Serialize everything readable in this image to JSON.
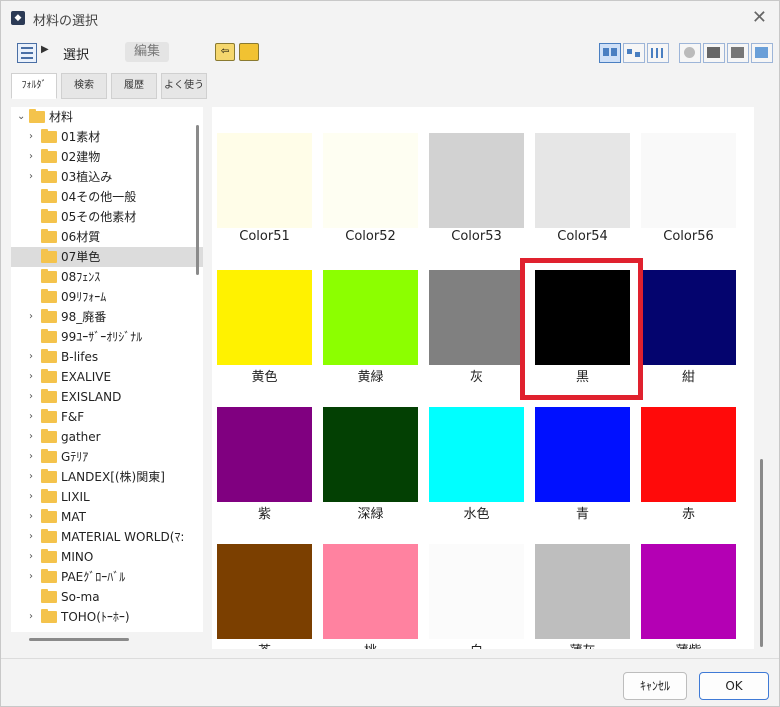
{
  "window": {
    "title": "材料の選択"
  },
  "toolbar": {
    "select_label": "選択",
    "edit_label": "編集"
  },
  "tabs": [
    "ﾌｫﾙﾀﾞ",
    "検索",
    "履歴",
    "よく使う"
  ],
  "tree": {
    "items": [
      {
        "label": "材料",
        "chev": "⌄",
        "level": 0,
        "selected": false
      },
      {
        "label": "01素材",
        "chev": "›",
        "level": 1,
        "selected": false
      },
      {
        "label": "02建物",
        "chev": "›",
        "level": 1,
        "selected": false
      },
      {
        "label": "03植込み",
        "chev": "›",
        "level": 1,
        "selected": false
      },
      {
        "label": "04その他一般",
        "chev": "",
        "level": 1,
        "selected": false
      },
      {
        "label": "05その他素材",
        "chev": "",
        "level": 1,
        "selected": false
      },
      {
        "label": "06材質",
        "chev": "",
        "level": 1,
        "selected": false
      },
      {
        "label": "07単色",
        "chev": "",
        "level": 1,
        "selected": true
      },
      {
        "label": "08ﾌｪﾝｽ",
        "chev": "",
        "level": 1,
        "selected": false
      },
      {
        "label": "09ﾘﾌｫｰﾑ",
        "chev": "",
        "level": 1,
        "selected": false
      },
      {
        "label": "98_廃番",
        "chev": "›",
        "level": 1,
        "selected": false
      },
      {
        "label": "99ﾕｰｻﾞｰｵﾘｼﾞﾅﾙ",
        "chev": "",
        "level": 1,
        "selected": false
      },
      {
        "label": "B-lifes",
        "chev": "›",
        "level": 1,
        "selected": false
      },
      {
        "label": "EXALIVE",
        "chev": "›",
        "level": 1,
        "selected": false
      },
      {
        "label": "EXISLAND",
        "chev": "›",
        "level": 1,
        "selected": false
      },
      {
        "label": "F&F",
        "chev": "›",
        "level": 1,
        "selected": false
      },
      {
        "label": "gather",
        "chev": "›",
        "level": 1,
        "selected": false
      },
      {
        "label": "Gﾃﾘｱ",
        "chev": "›",
        "level": 1,
        "selected": false
      },
      {
        "label": "LANDEX[(株)関東]",
        "chev": "›",
        "level": 1,
        "selected": false
      },
      {
        "label": "LIXIL",
        "chev": "›",
        "level": 1,
        "selected": false
      },
      {
        "label": "MAT",
        "chev": "›",
        "level": 1,
        "selected": false
      },
      {
        "label": "MATERIAL WORLD(ﾏ:",
        "chev": "›",
        "level": 1,
        "selected": false
      },
      {
        "label": "MINO",
        "chev": "›",
        "level": 1,
        "selected": false
      },
      {
        "label": "PAEｸﾞﾛｰﾊﾞﾙ",
        "chev": "›",
        "level": 1,
        "selected": false
      },
      {
        "label": "So-ma",
        "chev": "",
        "level": 1,
        "selected": false
      },
      {
        "label": "TOHO(ﾄｰﾎｰ)",
        "chev": "›",
        "level": 1,
        "selected": false
      }
    ]
  },
  "materials": [
    {
      "label": "Color51",
      "color": "#fffde8"
    },
    {
      "label": "Color52",
      "color": "#fefef2"
    },
    {
      "label": "Color53",
      "color": "#d2d2d2"
    },
    {
      "label": "Color54",
      "color": "#e6e6e6"
    },
    {
      "label": "Color56",
      "color": "#f9f9f9"
    },
    {
      "label": "黄色",
      "color": "#fff200"
    },
    {
      "label": "黄緑",
      "color": "#8cff00"
    },
    {
      "label": "灰",
      "color": "#808080"
    },
    {
      "label": "黒",
      "color": "#000000"
    },
    {
      "label": "紺",
      "color": "#04046e"
    },
    {
      "label": "紫",
      "color": "#800080"
    },
    {
      "label": "深緑",
      "color": "#034003"
    },
    {
      "label": "水色",
      "color": "#00ffff"
    },
    {
      "label": "青",
      "color": "#0010ff"
    },
    {
      "label": "赤",
      "color": "#ff0a0a"
    },
    {
      "label": "茶",
      "color": "#7b3f00"
    },
    {
      "label": "桃",
      "color": "#ff82a0"
    },
    {
      "label": "白",
      "color": "#fbfbfb"
    },
    {
      "label": "薄灰",
      "color": "#bebebe"
    },
    {
      "label": "薄紫",
      "color": "#b400b4"
    }
  ],
  "highlight_color": "#e0212e",
  "footer": {
    "cancel_label": "ｷｬﾝｾﾙ",
    "ok_label": "OK"
  }
}
